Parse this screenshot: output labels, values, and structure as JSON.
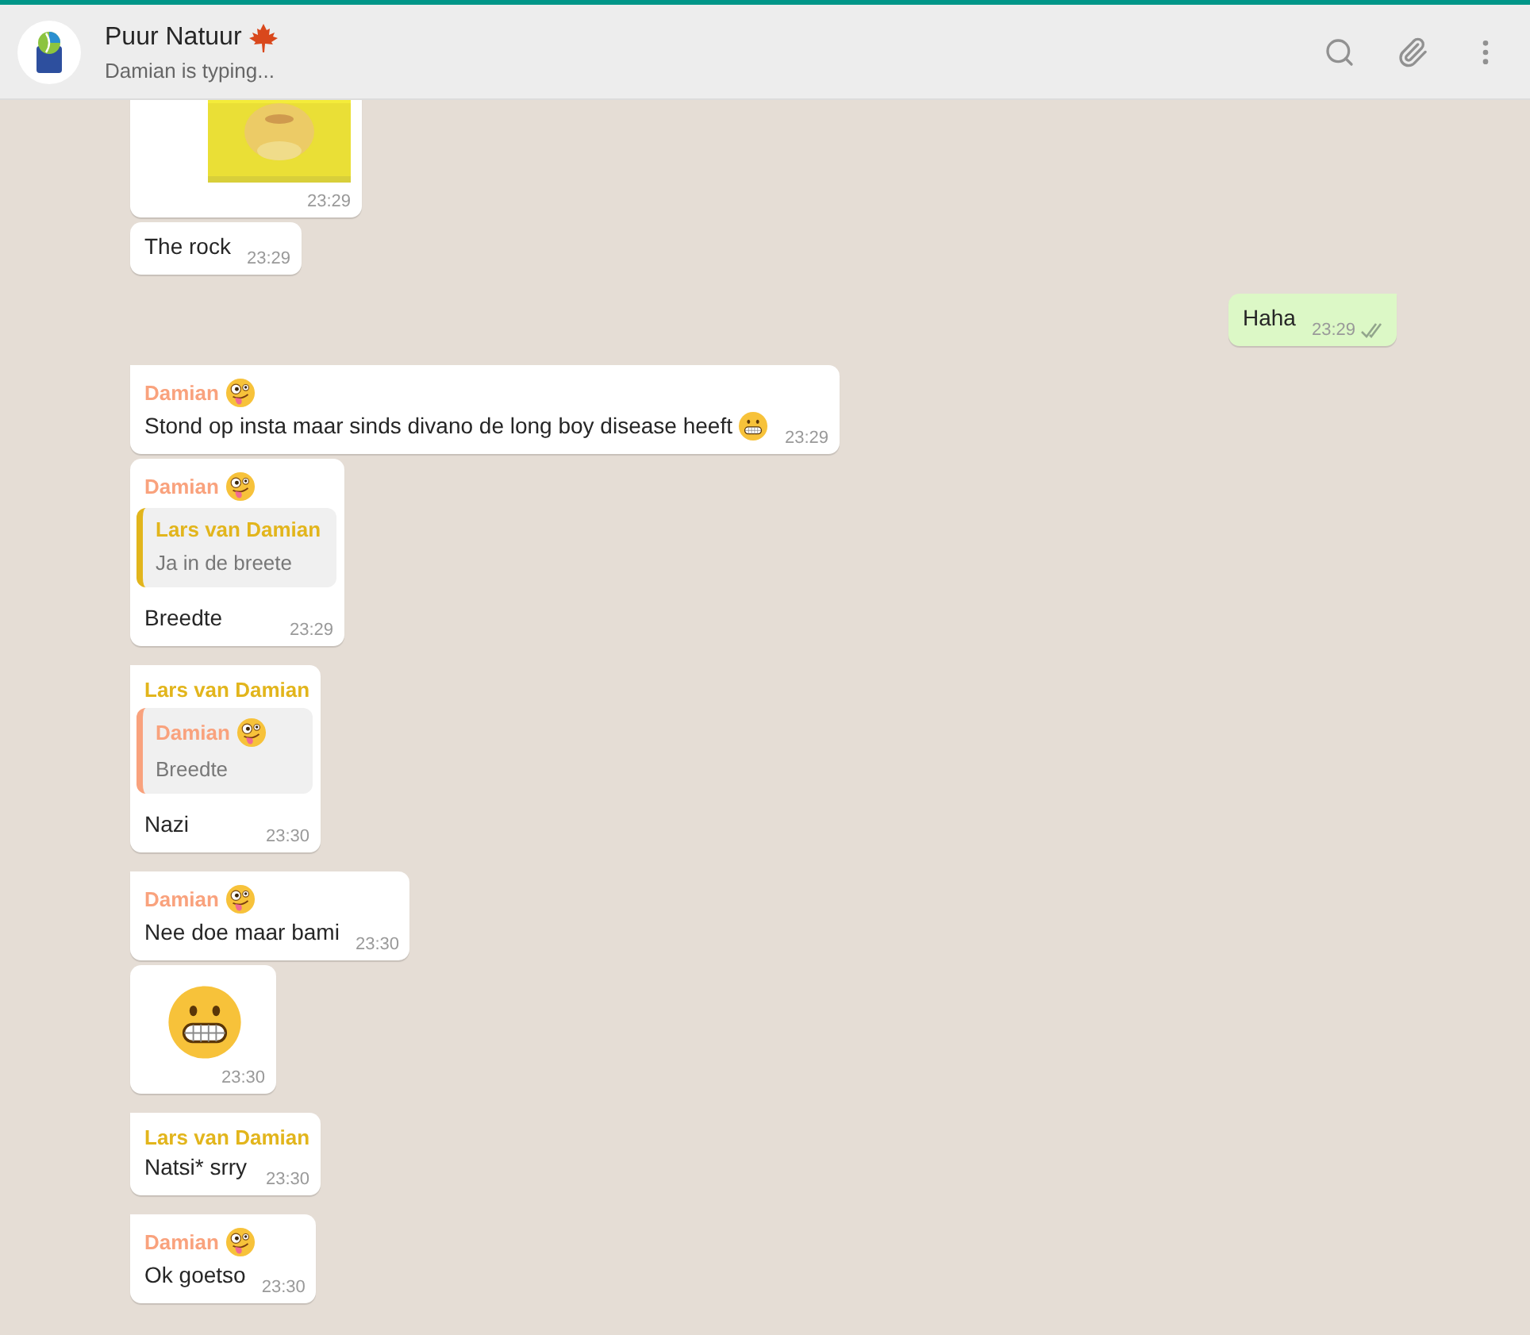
{
  "header": {
    "title": "Puur Natuur",
    "title_emoji": true,
    "status": "Damian is typing..."
  },
  "messages": [
    {
      "outgoing": false,
      "first_in_group": false,
      "time": "23:29"
    },
    {
      "kind": "text",
      "outgoing": false,
      "first_in_group": false,
      "text": "The rock",
      "time": "23:29"
    },
    {
      "kind": "text",
      "outgoing": true,
      "first_in_group": true,
      "text": "Haha",
      "time": "23:29",
      "read": false
    },
    {
      "kind": "text",
      "outgoing": false,
      "first_in_group": true,
      "sender": "Damian",
      "sender_emoji": true,
      "color": "#f9a27d",
      "text": "Stond op insta maar sinds divano de long boy disease heeft",
      "trailing_emoji": true,
      "time": "23:29"
    },
    {
      "kind": "text",
      "outgoing": false,
      "first_in_group": false,
      "sender": "Damian",
      "sender_emoji": true,
      "color": "#f9a27d",
      "quote": {
        "author": "Lars van Damian",
        "color": "#e2b51c",
        "text": "Ja in de breete"
      },
      "text": "Breedte",
      "time": "23:29"
    },
    {
      "kind": "text",
      "outgoing": false,
      "first_in_group": true,
      "sender": "Lars van Damian",
      "color": "#e2b51c",
      "quote": {
        "author": "Damian",
        "author_emoji": true,
        "color": "#f9a27d",
        "text": "Breedte"
      },
      "text": "Nazi",
      "time": "23:30"
    },
    {
      "kind": "text",
      "outgoing": false,
      "first_in_group": true,
      "sender": "Damian",
      "sender_emoji": true,
      "color": "#f9a27d",
      "text": "Nee doe maar bami",
      "time": "23:30"
    },
    {
      "kind": "emoji",
      "outgoing": false,
      "first_in_group": false,
      "time": "23:30"
    },
    {
      "kind": "text",
      "outgoing": false,
      "first_in_group": true,
      "sender": "Lars van Damian",
      "color": "#e2b51c",
      "text": "Natsi* srry",
      "time": "23:30"
    },
    {
      "kind": "text",
      "outgoing": false,
      "first_in_group": true,
      "sender": "Damian",
      "sender_emoji": true,
      "color": "#f9a27d",
      "text": "Ok goetso",
      "time": "23:30"
    }
  ]
}
